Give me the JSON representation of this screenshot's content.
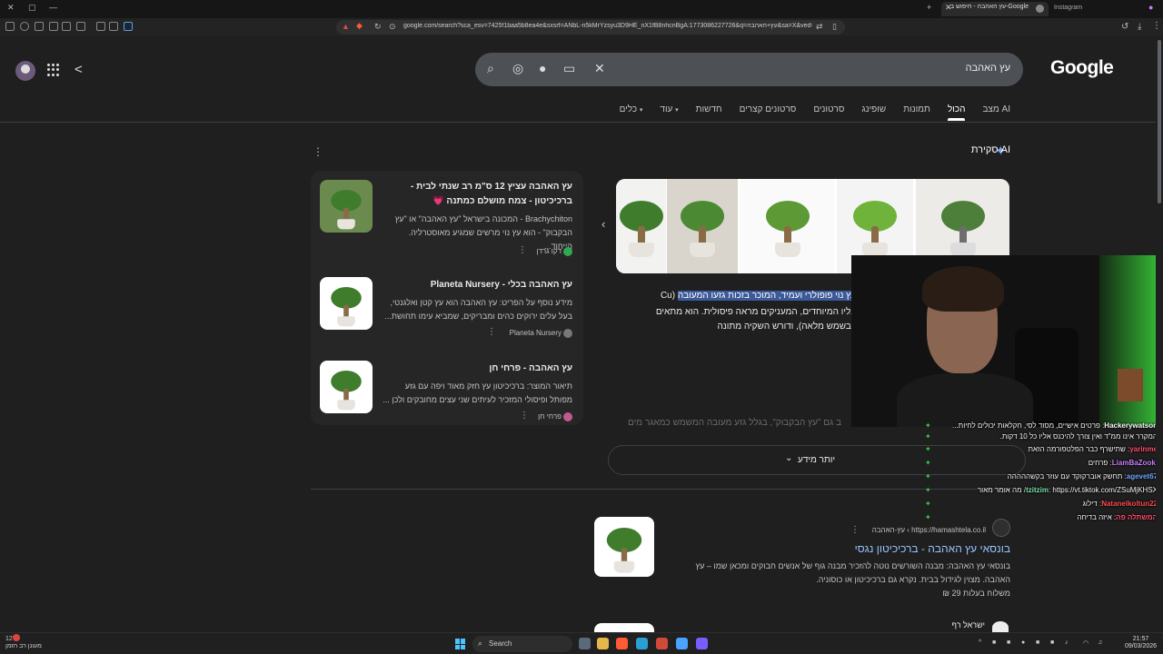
{
  "browser": {
    "active_tab_title": "עץ האהבה - חיפוש ב-Google",
    "second_tab_title": "Instagram",
    "url": "google.com/search?sca_esv=7425f1baa5b8ea4e&sxsrf=ANbL-n5kMrYzsyu3D9HE_nX1fB8nhcnBgA:1773086227726&q=עץ+האהבה&sa=X&ved=2ahUKEwj&source=In..."
  },
  "google": {
    "logo": "Google",
    "search_query": "עץ האהבה",
    "tabs": [
      "מצב AI",
      "הכול",
      "תמונות",
      "שופינג",
      "סרטונים",
      "סרטונים קצרים",
      "חדשות",
      "עוד",
      "כלים"
    ],
    "active_tab": "הכול"
  },
  "ai_overview": {
    "title": "סקירת AI",
    "highlighted": "הוא עץ נוי פופולרי ועמיד, המוכר בזכות גזעו המעובה",
    "partial_text": "(Cu",
    "line2": "ים) ועליו המיוחדים, המעניקים מראה פיסולית. הוא מתאים",
    "line3": "גינה (בשמש מלאה), ודורש השקיה מתונה",
    "faded_line": "ב גם \"עץ הבקבוק\", בגלל גזע מעובה המשמש כמאגר מים",
    "show_more": "יותר מידע"
  },
  "sources": [
    {
      "title_line1": "עץ האהבה עציץ 12 ס\"מ רב שנתי לבית -",
      "title_line2": "ברכיכיטון - צמח מושלם כמתנה 💗",
      "snippet": "Brachychiton - המכונה בישראל \"עץ האהבה\" או \"עץ הבקבוק\" - הוא עץ נוי מרשים שמגיע מאוסטרליה. הייחוד...",
      "site": "דקו גרדן"
    },
    {
      "title_line1": "עץ האהבה בכלי - Planeta Nursery",
      "snippet": "מידע נוסף על הפריט: עץ האהבה הוא עץ קטן ואלגנטי, בעל עלים ירוקים כהים ומבריקים, שמביא עימו תחושת...",
      "site": "Planeta Nursery"
    },
    {
      "title_line1": "עץ האהבה - פרחי חן",
      "snippet": "תיאור המוצר: ברכיכיטון עץ חזק מאוד ויפה עם גזע מפותל ופיסולי המזכיר לעיתים שני עצים מחובקים ולכן ...",
      "site": "פרחי חן"
    }
  ],
  "result": {
    "url": "https://hamashtela.co.il › עץ-האהבה",
    "title": "בונסאי עץ האהבה - ברכיכיטון נגסי",
    "snippet_line1": "בונסאי עץ האהבה: מבנה השורשים נוטה להזכיר מבנה גוף של אנשים חבוקים ומכאן שמו – עץ",
    "snippet_line2": "האהבה. מצוין לגידול בבית. נקרא גם ברכיכיטון או כוסוניה.",
    "shipping": "משלוח בעלות 29 ₪"
  },
  "result2": {
    "site": "ישראל רף"
  },
  "chat": [
    {
      "user": "Hackerywatson",
      "text": "פרטים אישיים, מסוד לסי, חקלאות יכולים לחיות...",
      "color": "#f5f5f5"
    },
    {
      "user": "",
      "text": "המקרר אינו ממ\"ד ואין צורך להיכנס אליו כל 10 דקות.",
      "color": "#f5f5f5"
    },
    {
      "user": "yarinme",
      "text": "שתישרף כבר הפלטפורמה הזאת",
      "color": "#ff4d6d"
    },
    {
      "user": "LiamBaZooki",
      "text": "פרחים",
      "color": "#c77dff"
    },
    {
      "user": "agevet67",
      "text": "תחשק אוברקוקד עם עוזר בקשההההה",
      "color": "#6ea8ff"
    },
    {
      "user": "tzitzim",
      "text": "https://vt.tiktok.com/ZSuMjKHSX/ מה אומר מאור",
      "color": "#7ee0a8"
    },
    {
      "user": "Natanelkoltun22",
      "text": "דילוג",
      "color": "#ff4d4d"
    },
    {
      "user": "המשתלה פה",
      "text": "איזה בדיחה",
      "color": "#ff4d6d"
    }
  ],
  "taskbar": {
    "weather_temp": "12°C",
    "weather_desc": "מעונן רב הזמן",
    "search_label": "Search",
    "time": "21:57",
    "date": "09/03/2026"
  }
}
